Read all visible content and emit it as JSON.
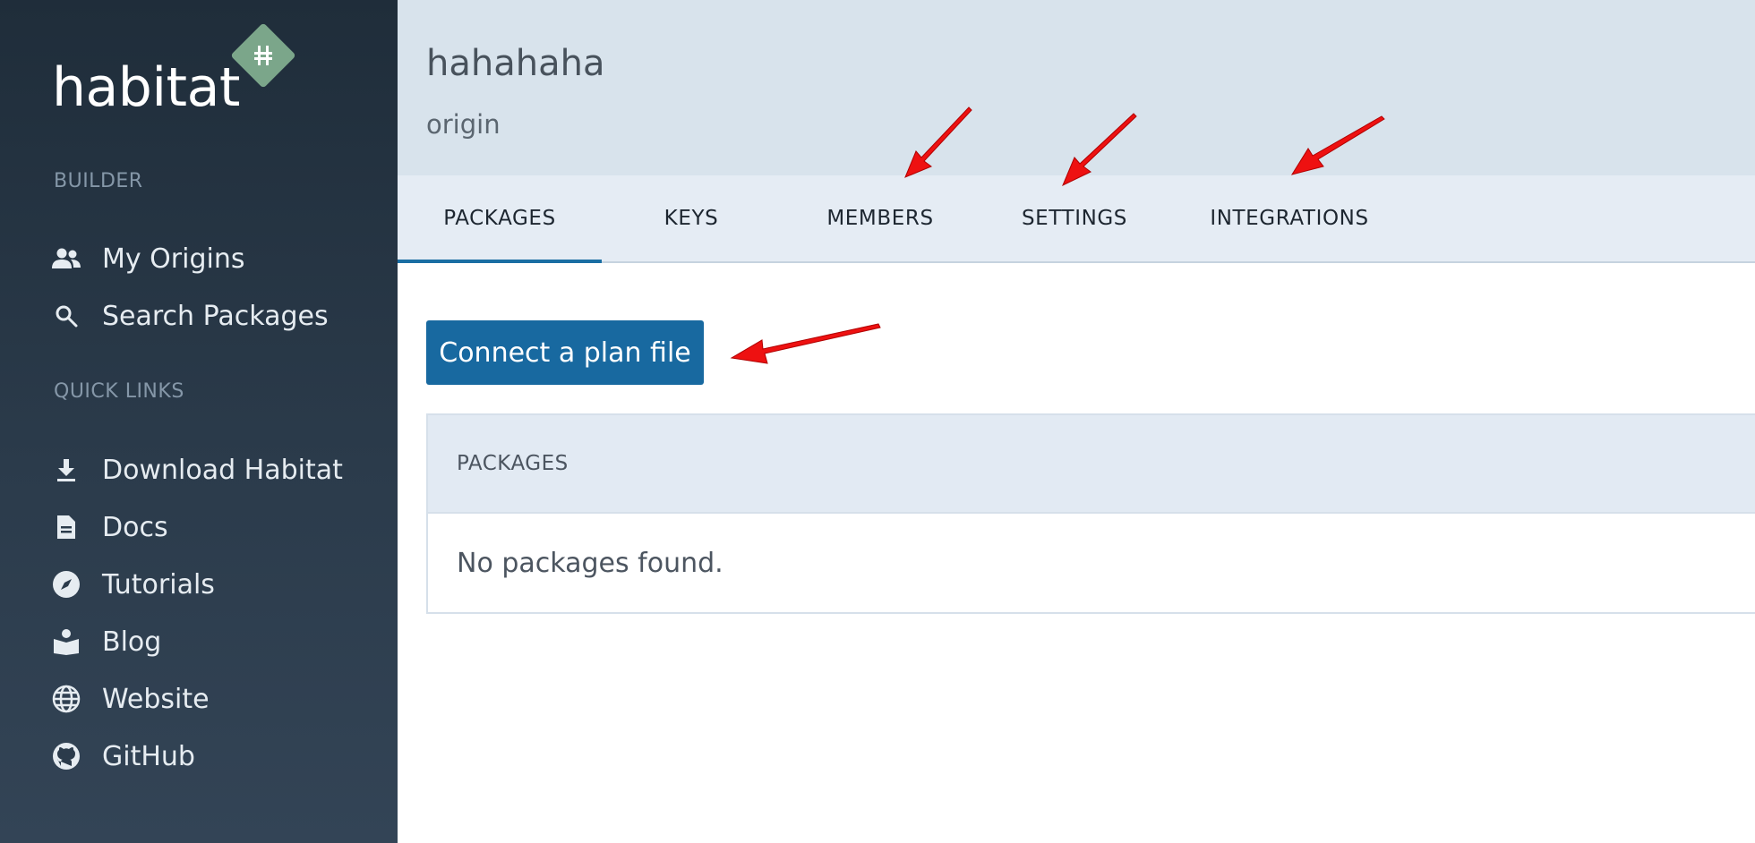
{
  "app": {
    "logo_text": "habitat"
  },
  "sidebar": {
    "builder_heading": "BUILDER",
    "builder_items": [
      {
        "label": "My Origins",
        "icon": "people-icon"
      },
      {
        "label": "Search Packages",
        "icon": "search-icon"
      }
    ],
    "quick_links_heading": "QUICK LINKS",
    "quick_links": [
      {
        "label": "Download Habitat",
        "icon": "download-icon"
      },
      {
        "label": "Docs",
        "icon": "document-icon"
      },
      {
        "label": "Tutorials",
        "icon": "compass-icon"
      },
      {
        "label": "Blog",
        "icon": "book-reader-icon"
      },
      {
        "label": "Website",
        "icon": "globe-icon"
      },
      {
        "label": "GitHub",
        "icon": "github-icon"
      }
    ]
  },
  "header": {
    "title": "hahahaha",
    "subtitle": "origin"
  },
  "tabs": [
    {
      "label": "PACKAGES",
      "active": true
    },
    {
      "label": "KEYS",
      "active": false
    },
    {
      "label": "MEMBERS",
      "active": false
    },
    {
      "label": "SETTINGS",
      "active": false
    },
    {
      "label": "INTEGRATIONS",
      "active": false
    }
  ],
  "main": {
    "connect_button_label": "Connect a plan file",
    "packages_panel": {
      "heading": "PACKAGES",
      "empty_message": "No packages found."
    }
  },
  "colors": {
    "sidebar_bg": "#1f2d3a",
    "header_bg": "#d8e3ec",
    "tabs_bg": "#e5ecf4",
    "accent": "#1869a0",
    "logo_green": "#7ba68a",
    "annotation_arrow": "#ee1111"
  }
}
